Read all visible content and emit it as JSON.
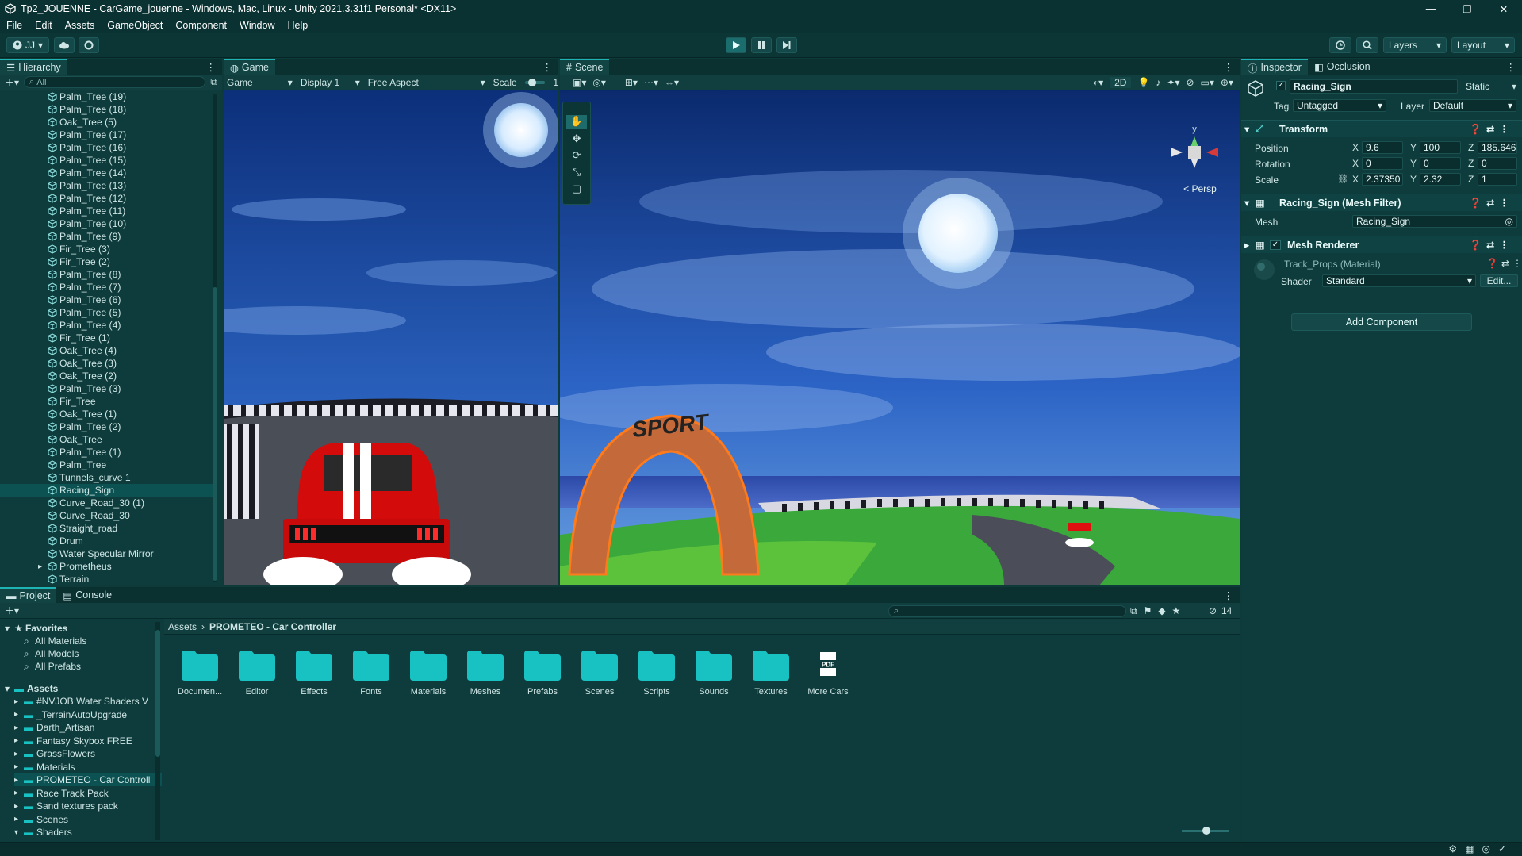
{
  "window": {
    "title": "Tp2_JOUENNE - CarGame_jouenne - Windows, Mac, Linux - Unity 2021.3.31f1 Personal* <DX11>",
    "controls": [
      "—",
      "❐",
      "✕"
    ]
  },
  "menu": [
    "File",
    "Edit",
    "Assets",
    "GameObject",
    "Component",
    "Window",
    "Help"
  ],
  "toolbar": {
    "account": "JJ",
    "layers_label": "Layers",
    "layout_label": "Layout"
  },
  "hierarchy": {
    "tab": "Hierarchy",
    "search_placeholder": "All",
    "items": [
      "Palm_Tree (19)",
      "Palm_Tree (18)",
      "Oak_Tree (5)",
      "Palm_Tree (17)",
      "Palm_Tree (16)",
      "Palm_Tree (15)",
      "Palm_Tree (14)",
      "Palm_Tree (13)",
      "Palm_Tree (12)",
      "Palm_Tree (11)",
      "Palm_Tree (10)",
      "Palm_Tree (9)",
      "Fir_Tree (3)",
      "Fir_Tree (2)",
      "Palm_Tree (8)",
      "Palm_Tree (7)",
      "Palm_Tree (6)",
      "Palm_Tree (5)",
      "Palm_Tree (4)",
      "Fir_Tree (1)",
      "Oak_Tree (4)",
      "Oak_Tree (3)",
      "Oak_Tree (2)",
      "Palm_Tree (3)",
      "Fir_Tree",
      "Oak_Tree (1)",
      "Palm_Tree (2)",
      "Oak_Tree",
      "Palm_Tree (1)",
      "Palm_Tree",
      "Tunnels_curve 1",
      "Racing_Sign",
      "Curve_Road_30 (1)",
      "Curve_Road_30",
      "Straight_road",
      "Drum",
      "Water Specular Mirror",
      "Prometheus",
      "Terrain"
    ],
    "selected_index": 31
  },
  "game": {
    "tab": "Game",
    "mode": "Game",
    "display": "Display 1",
    "aspect": "Free Aspect",
    "scale_label": "Scale",
    "scale_value": "1"
  },
  "scene": {
    "tab": "Scene",
    "mode_2d": "2D",
    "persp_label": "< Persp",
    "gizmo_y": "y",
    "sign_text": "SPORT"
  },
  "inspector": {
    "tab": "Inspector",
    "tab2": "Occlusion",
    "object_name": "Racing_Sign",
    "static_label": "Static",
    "tag_label": "Tag",
    "tag_value": "Untagged",
    "layer_label": "Layer",
    "layer_value": "Default",
    "transform": {
      "title": "Transform",
      "position_label": "Position",
      "rotation_label": "Rotation",
      "scale_label": "Scale",
      "position": {
        "x": "9.6",
        "y": "100",
        "z": "185.646"
      },
      "rotation": {
        "x": "0",
        "y": "0",
        "z": "0"
      },
      "scale": {
        "x": "2.37350",
        "y": "2.32",
        "z": "1"
      }
    },
    "mesh_filter": {
      "title": "Racing_Sign (Mesh Filter)",
      "mesh_label": "Mesh",
      "mesh_value": "Racing_Sign"
    },
    "mesh_renderer": {
      "title": "Mesh Renderer"
    },
    "material": {
      "name": "Track_Props (Material)",
      "shader_label": "Shader",
      "shader_value": "Standard",
      "edit_label": "Edit..."
    },
    "add_component": "Add Component",
    "axis": {
      "x": "X",
      "y": "Y",
      "z": "Z"
    }
  },
  "project": {
    "tab": "Project",
    "tab2": "Console",
    "favorites_label": "Favorites",
    "favorites": [
      "All Materials",
      "All Models",
      "All Prefabs"
    ],
    "assets_label": "Assets",
    "asset_folders": [
      "#NVJOB Water Shaders V",
      "_TerrainAutoUpgrade",
      "Darth_Artisan",
      "Fantasy Skybox FREE",
      "GrassFlowers",
      "Materials",
      "PROMETEO - Car Controll",
      "Race Track Pack",
      "Sand textures pack",
      "Scenes",
      "Shaders"
    ],
    "breadcrumb": [
      "Assets",
      "PROMETEO - Car Controller"
    ],
    "hidden_count": "14",
    "tiles": [
      "Documen...",
      "Editor",
      "Effects",
      "Fonts",
      "Materials",
      "Meshes",
      "Prefabs",
      "Scenes",
      "Scripts",
      "Sounds",
      "Textures",
      "More Cars"
    ],
    "pdf_label": "PDF"
  },
  "colors": {
    "accent": "#1fb3b3",
    "folder": "#19c2c2",
    "panel": "#0e3b3b",
    "selection": "#0d5252"
  }
}
